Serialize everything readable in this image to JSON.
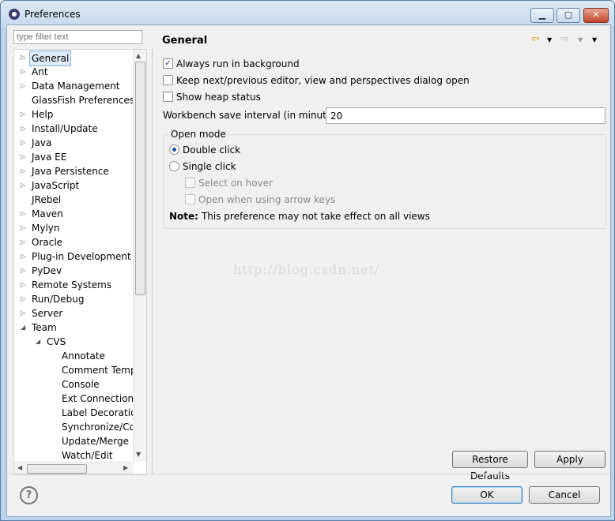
{
  "window": {
    "title": "Preferences",
    "buttons": {
      "minimize": "▁",
      "maximize": "▢",
      "close": "✕"
    }
  },
  "filter": {
    "placeholder": "type filter text"
  },
  "tree": {
    "items": [
      {
        "label": "General",
        "level": 0,
        "expander": "collapsed",
        "selected": true
      },
      {
        "label": "Ant",
        "level": 0,
        "expander": "collapsed"
      },
      {
        "label": "Data Management",
        "level": 0,
        "expander": "collapsed"
      },
      {
        "label": "GlassFish Preferences",
        "level": 0,
        "expander": "none"
      },
      {
        "label": "Help",
        "level": 0,
        "expander": "collapsed"
      },
      {
        "label": "Install/Update",
        "level": 0,
        "expander": "collapsed"
      },
      {
        "label": "Java",
        "level": 0,
        "expander": "collapsed"
      },
      {
        "label": "Java EE",
        "level": 0,
        "expander": "collapsed"
      },
      {
        "label": "Java Persistence",
        "level": 0,
        "expander": "collapsed"
      },
      {
        "label": "JavaScript",
        "level": 0,
        "expander": "collapsed"
      },
      {
        "label": "JRebel",
        "level": 0,
        "expander": "none"
      },
      {
        "label": "Maven",
        "level": 0,
        "expander": "collapsed"
      },
      {
        "label": "Mylyn",
        "level": 0,
        "expander": "collapsed"
      },
      {
        "label": "Oracle",
        "level": 0,
        "expander": "collapsed"
      },
      {
        "label": "Plug-in Development",
        "level": 0,
        "expander": "collapsed"
      },
      {
        "label": "PyDev",
        "level": 0,
        "expander": "collapsed"
      },
      {
        "label": "Remote Systems",
        "level": 0,
        "expander": "collapsed"
      },
      {
        "label": "Run/Debug",
        "level": 0,
        "expander": "collapsed"
      },
      {
        "label": "Server",
        "level": 0,
        "expander": "collapsed"
      },
      {
        "label": "Team",
        "level": 0,
        "expander": "expanded"
      },
      {
        "label": "CVS",
        "level": 1,
        "expander": "expanded"
      },
      {
        "label": "Annotate",
        "level": 2,
        "expander": "none"
      },
      {
        "label": "Comment Temp",
        "level": 2,
        "expander": "none"
      },
      {
        "label": "Console",
        "level": 2,
        "expander": "none"
      },
      {
        "label": "Ext Connection M",
        "level": 2,
        "expander": "none"
      },
      {
        "label": "Label Decoration",
        "level": 2,
        "expander": "none"
      },
      {
        "label": "Synchronize/Con",
        "level": 2,
        "expander": "none"
      },
      {
        "label": "Update/Merge",
        "level": 2,
        "expander": "none"
      },
      {
        "label": "Watch/Edit",
        "level": 2,
        "expander": "none"
      }
    ]
  },
  "page": {
    "title": "General",
    "checkboxes": [
      {
        "label": "Always run in background",
        "checked": true
      },
      {
        "label": "Keep next/previous editor, view and perspectives dialog open",
        "checked": false
      },
      {
        "label": "Show heap status",
        "checked": false
      }
    ],
    "save_interval": {
      "label": "Workbench save interval (in minutes):",
      "value": "20"
    },
    "open_mode": {
      "label": "Open mode",
      "double_click": "Double click",
      "single_click": "Single click",
      "select_on_hover": "Select on hover",
      "open_arrow_keys": "Open when using arrow keys",
      "note_label": "Note:",
      "note_text": "This preference may not take effect on all views"
    },
    "watermark": "http://blog.csdn.net/"
  },
  "buttons": {
    "restore_defaults": "Restore Defaults",
    "apply": "Apply",
    "ok": "OK",
    "cancel": "Cancel"
  },
  "help": {
    "glyph": "?"
  },
  "colors": {
    "accent": "#3c7fb1",
    "selection": "#dfeaf7"
  }
}
